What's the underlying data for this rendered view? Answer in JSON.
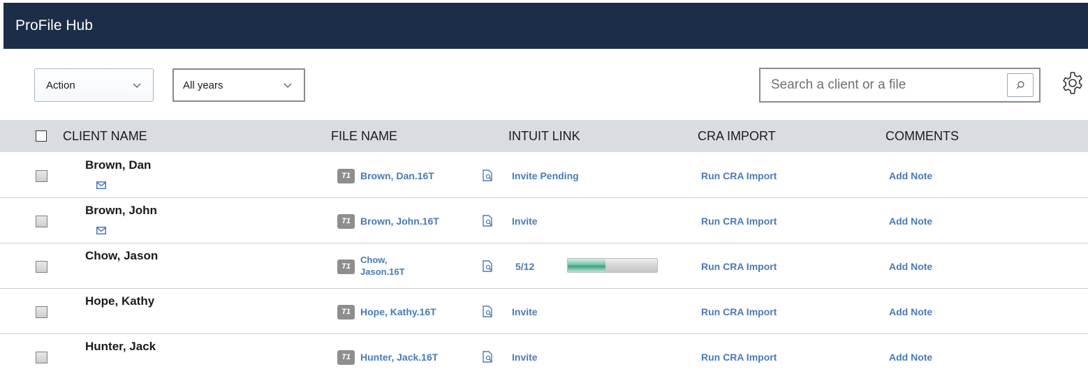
{
  "app": {
    "title": "ProFile Hub"
  },
  "toolbar": {
    "action_label": "Action",
    "years_label": "All years",
    "search_placeholder": "Search a client or a file"
  },
  "table": {
    "columns": [
      "CLIENT NAME",
      "FILE NAME",
      "INTUIT LINK",
      "CRA IMPORT",
      "COMMENTS"
    ],
    "rows": [
      {
        "client": "Brown, Dan",
        "has_email": true,
        "file_type": "T1",
        "file": "Brown, Dan.16T",
        "link": "Invite Pending",
        "cra": "Run CRA Import",
        "comment": "Add Note"
      },
      {
        "client": "Brown, John",
        "has_email": true,
        "file_type": "T1",
        "file": "Brown, John.16T",
        "link": "Invite",
        "cra": "Run CRA Import",
        "comment": "Add Note"
      },
      {
        "client": "Chow, Jason",
        "has_email": false,
        "file_type": "T1",
        "file_line1": "Chow,",
        "file_line2": "Jason.16T",
        "link": "5/12",
        "progress": 0.42,
        "cra": "Run CRA Import",
        "comment": "Add Note"
      },
      {
        "client": "Hope, Kathy",
        "has_email": false,
        "file_type": "T1",
        "file": "Hope, Kathy.16T",
        "link": "Invite",
        "cra": "Run CRA Import",
        "comment": "Add Note"
      },
      {
        "client": "Hunter, Jack",
        "has_email": false,
        "file_type": "T1",
        "file": "Hunter, Jack.16T",
        "link": "Invite",
        "cra": "Run CRA Import",
        "comment": "Add Note"
      }
    ]
  },
  "icons": {
    "chevron": "chevron-down-icon",
    "search": "search-icon",
    "settings": "gear-icon",
    "mail": "mail-icon",
    "view": "view-file-icon"
  },
  "colors": {
    "titlebar": "#1b2d47",
    "header_bg": "#d9dde2",
    "link": "#4a7ab5"
  }
}
